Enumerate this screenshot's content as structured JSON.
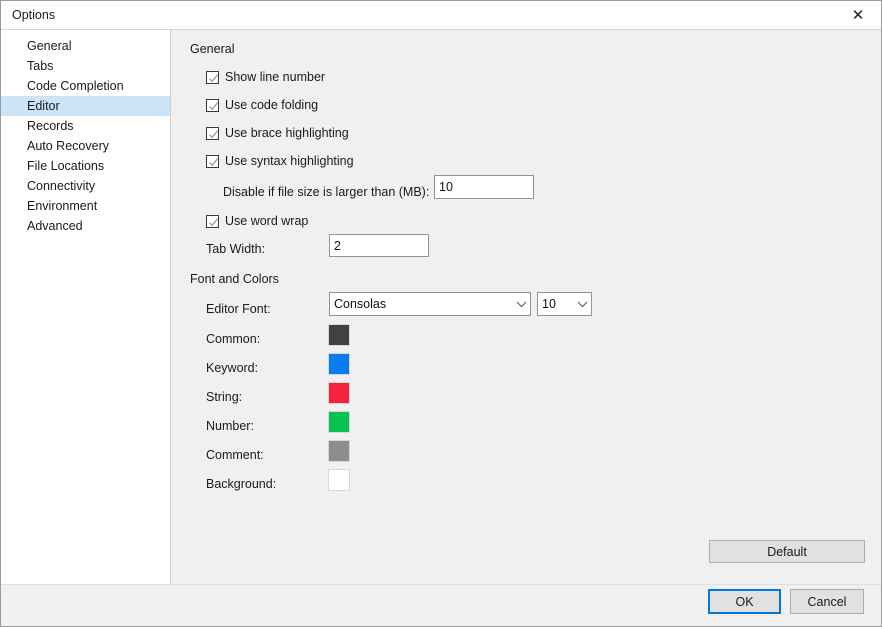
{
  "window": {
    "title": "Options",
    "close_icon": "close-icon"
  },
  "sidebar": {
    "items": [
      {
        "label": "General",
        "selected": false
      },
      {
        "label": "Tabs",
        "selected": false
      },
      {
        "label": "Code Completion",
        "selected": false
      },
      {
        "label": "Editor",
        "selected": true
      },
      {
        "label": "Records",
        "selected": false
      },
      {
        "label": "Auto Recovery",
        "selected": false
      },
      {
        "label": "File Locations",
        "selected": false
      },
      {
        "label": "Connectivity",
        "selected": false
      },
      {
        "label": "Environment",
        "selected": false
      },
      {
        "label": "Advanced",
        "selected": false
      }
    ]
  },
  "content": {
    "general": {
      "heading": "General",
      "checkboxes": [
        {
          "label": "Show line number",
          "checked": true
        },
        {
          "label": "Use code folding",
          "checked": true
        },
        {
          "label": "Use brace highlighting",
          "checked": true
        },
        {
          "label": "Use syntax highlighting",
          "checked": true
        }
      ],
      "disable_if_larger": {
        "label": "Disable if file size is larger than (MB):",
        "value": "10"
      },
      "word_wrap": {
        "label": "Use word wrap",
        "checked": true
      },
      "tab_width": {
        "label": "Tab Width:",
        "value": "2"
      }
    },
    "font_and_colors": {
      "heading": "Font and Colors",
      "editor_font": {
        "label": "Editor Font:",
        "value": "Consolas",
        "size_value": "10"
      },
      "colors": [
        {
          "label": "Common:",
          "hex": "#414141"
        },
        {
          "label": "Keyword:",
          "hex": "#0a7cf0"
        },
        {
          "label": "String:",
          "hex": "#f5223f"
        },
        {
          "label": "Number:",
          "hex": "#06c250"
        },
        {
          "label": "Comment:",
          "hex": "#8d8d8d"
        },
        {
          "label": "Background:",
          "hex": "#ffffff"
        }
      ]
    },
    "default_button": "Default"
  },
  "footer": {
    "ok": "OK",
    "cancel": "Cancel"
  },
  "theme": {
    "selection_blue": "#cce4f7",
    "focus_blue": "#0078d7",
    "dialog_bg": "#f0f0f0"
  }
}
